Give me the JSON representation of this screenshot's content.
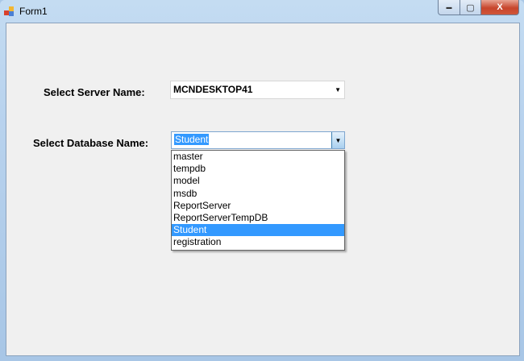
{
  "window": {
    "title": "Form1",
    "minimize_label": "▬",
    "maximize_label": "▢",
    "close_label": "X"
  },
  "form": {
    "server_label": "Select Server Name:",
    "server_value": "MCNDESKTOP41",
    "database_label": "Select Database Name:",
    "database_value": "Student",
    "database_options": [
      "master",
      "tempdb",
      "model",
      "msdb",
      "ReportServer",
      "ReportServerTempDB",
      "Student",
      "registration"
    ],
    "selected_index": 6
  },
  "colors": {
    "selection": "#3399ff"
  }
}
